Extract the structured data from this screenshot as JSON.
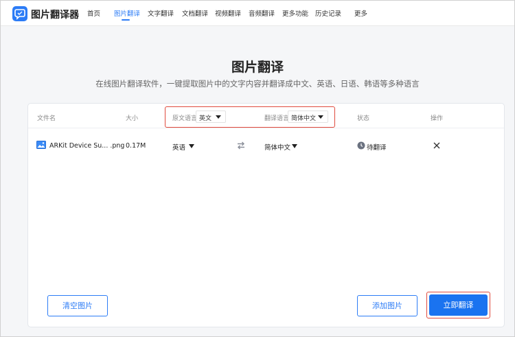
{
  "header": {
    "brand": "图片翻译器",
    "nav": [
      {
        "label": "首页"
      },
      {
        "label": "图片翻译"
      },
      {
        "label": "文字翻译"
      },
      {
        "label": "文档翻译"
      },
      {
        "label": "视频翻译"
      },
      {
        "label": "音频翻译"
      },
      {
        "label": "更多功能"
      },
      {
        "label": "历史记录"
      },
      {
        "label": "更多"
      }
    ]
  },
  "hero": {
    "title": "图片翻译",
    "subtitle": "在线图片翻译软件，一键提取图片中的文字内容并翻译成中文、英语、日语、韩语等多种语言"
  },
  "table": {
    "headers": {
      "filename": "文件名",
      "size": "大小",
      "source_label": "原文语言",
      "source_value": "英文",
      "target_label": "翻译语言",
      "target_value": "简体中文",
      "status": "状态",
      "action": "操作"
    },
    "rows": [
      {
        "filename": "ARKit Device Su... .png",
        "size": "0.17M",
        "source_lang": "英语",
        "target_lang": "简体中文",
        "status": "待翻译"
      }
    ]
  },
  "buttons": {
    "clear": "清空图片",
    "add": "添加图片",
    "translate": "立即翻译"
  },
  "colors": {
    "accent": "#2c7cf6",
    "primary_button": "#1a73f0",
    "highlight_border": "#e0493c"
  },
  "icons": {
    "logo": "translate-logo-icon",
    "file": "image-file-icon",
    "swap": "swap-arrows-icon",
    "status": "clock-icon",
    "remove": "close-icon"
  }
}
